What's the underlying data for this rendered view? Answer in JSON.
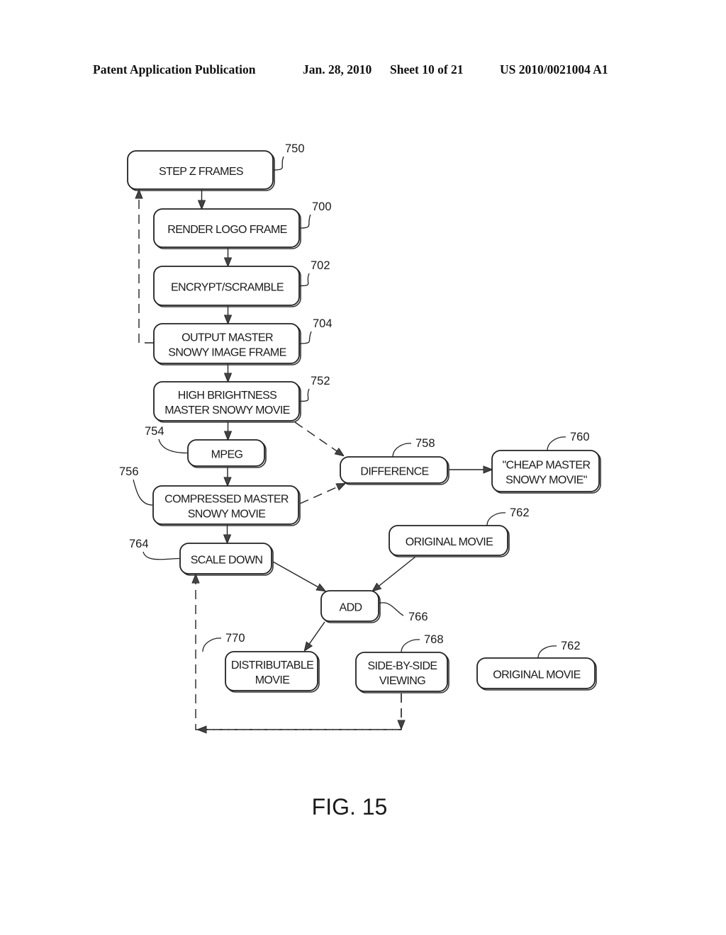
{
  "header": {
    "publication": "Patent Application Publication",
    "date": "Jan. 28, 2010",
    "sheet": "Sheet 10 of 21",
    "number": "US 2010/0021004 A1"
  },
  "figure_label": "FIG. 15",
  "nodes": {
    "step_z_frames": {
      "lines": [
        "STEP Z FRAMES"
      ],
      "ref": "750"
    },
    "render_logo_frame": {
      "lines": [
        "RENDER LOGO FRAME"
      ],
      "ref": "700"
    },
    "encrypt_scramble": {
      "lines": [
        "ENCRYPT/SCRAMBLE"
      ],
      "ref": "702"
    },
    "output_master": {
      "lines": [
        "OUTPUT MASTER",
        "SNOWY IMAGE FRAME"
      ],
      "ref": "704"
    },
    "high_brightness": {
      "lines": [
        "HIGH BRIGHTNESS",
        "MASTER SNOWY MOVIE"
      ],
      "ref": "752"
    },
    "mpeg": {
      "lines": [
        "MPEG"
      ],
      "ref": "754"
    },
    "compressed_master": {
      "lines": [
        "COMPRESSED MASTER",
        "SNOWY MOVIE"
      ],
      "ref": "756"
    },
    "difference": {
      "lines": [
        "DIFFERENCE"
      ],
      "ref": "758"
    },
    "cheap_master": {
      "lines": [
        "\"CHEAP MASTER",
        "SNOWY MOVIE\""
      ],
      "ref": "760"
    },
    "original_movie_1": {
      "lines": [
        "ORIGINAL MOVIE"
      ],
      "ref": "762"
    },
    "scale_down": {
      "lines": [
        "SCALE DOWN"
      ],
      "ref": "764"
    },
    "add": {
      "lines": [
        "ADD"
      ],
      "ref": "766"
    },
    "distributable_movie": {
      "lines": [
        "DISTRIBUTABLE",
        "MOVIE"
      ],
      "ref": "770"
    },
    "side_by_side": {
      "lines": [
        "SIDE-BY-SIDE",
        "VIEWING"
      ],
      "ref": "768"
    },
    "original_movie_2": {
      "lines": [
        "ORIGINAL MOVIE"
      ],
      "ref": "762"
    }
  },
  "edges": [
    {
      "from": "step_z_frames",
      "to": "render_logo_frame",
      "style": "solid"
    },
    {
      "from": "render_logo_frame",
      "to": "encrypt_scramble",
      "style": "solid"
    },
    {
      "from": "encrypt_scramble",
      "to": "output_master",
      "style": "solid"
    },
    {
      "from": "output_master",
      "to": "step_z_frames",
      "style": "dashed"
    },
    {
      "from": "output_master",
      "to": "high_brightness",
      "style": "solid"
    },
    {
      "from": "high_brightness",
      "to": "mpeg",
      "style": "solid"
    },
    {
      "from": "high_brightness",
      "to": "difference",
      "style": "dashed"
    },
    {
      "from": "mpeg",
      "to": "compressed_master",
      "style": "solid"
    },
    {
      "from": "compressed_master",
      "to": "difference",
      "style": "dashed"
    },
    {
      "from": "difference",
      "to": "cheap_master",
      "style": "solid"
    },
    {
      "from": "compressed_master",
      "to": "scale_down",
      "style": "solid"
    },
    {
      "from": "scale_down",
      "to": "add",
      "style": "solid"
    },
    {
      "from": "original_movie_1",
      "to": "add",
      "style": "solid"
    },
    {
      "from": "add",
      "to": "distributable_movie",
      "style": "solid"
    },
    {
      "from": "side_by_side",
      "to": "scale_down",
      "style": "dashed"
    }
  ]
}
